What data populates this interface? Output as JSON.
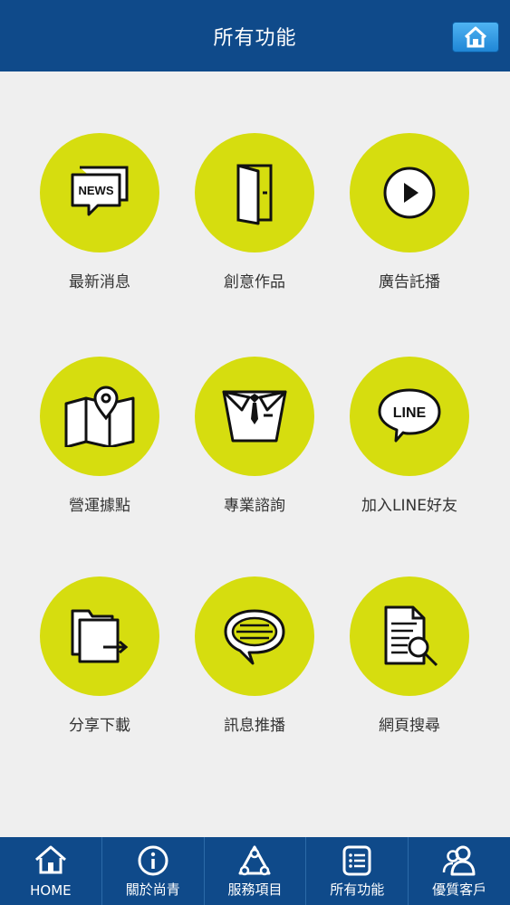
{
  "header": {
    "title": "所有功能",
    "home_icon": "home-icon"
  },
  "colors": {
    "header_bg": "#0f4a8a",
    "circle": "#d6dd0f",
    "bg": "#efefef"
  },
  "grid": {
    "items": [
      {
        "label": "最新消息",
        "icon": "news-icon",
        "icon_text": "NEWS"
      },
      {
        "label": "創意作品",
        "icon": "door-icon"
      },
      {
        "label": "廣告託播",
        "icon": "play-icon"
      },
      {
        "label": "營運據點",
        "icon": "map-pin-icon"
      },
      {
        "label": "專業諮詢",
        "icon": "suit-icon"
      },
      {
        "label": "加入LINE好友",
        "icon": "line-icon",
        "icon_text": "LINE"
      },
      {
        "label": "分享下載",
        "icon": "folder-share-icon"
      },
      {
        "label": "訊息推播",
        "icon": "chat-bubble-icon"
      },
      {
        "label": "網頁搜尋",
        "icon": "document-search-icon"
      }
    ]
  },
  "tabbar": {
    "items": [
      {
        "label": "HOME",
        "icon": "home-icon"
      },
      {
        "label": "關於尚青",
        "icon": "info-icon"
      },
      {
        "label": "服務項目",
        "icon": "services-icon"
      },
      {
        "label": "所有功能",
        "icon": "list-icon"
      },
      {
        "label": "優質客戶",
        "icon": "users-icon"
      }
    ]
  }
}
